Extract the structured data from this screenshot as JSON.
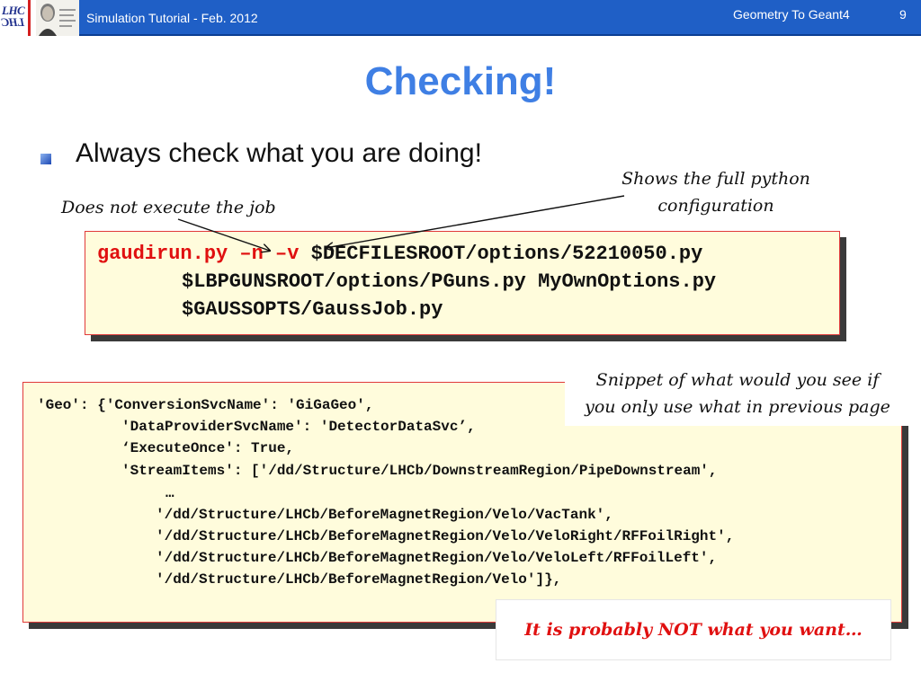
{
  "header": {
    "title": "Simulation Tutorial - Feb. 2012",
    "section": "Geometry To Geant4",
    "page_number": "9",
    "logo_text_top": "LHC",
    "logo_text_bottom": "LHC"
  },
  "slide": {
    "title": "Checking!",
    "bullet": "Always check what you are doing!"
  },
  "annotations": {
    "no_execute": "Does not execute the job",
    "python_config_line1": "Shows the full python",
    "python_config_line2": "configuration",
    "snippet_line1": "Snippet of what would you see if",
    "snippet_line2": "you only use what in previous page",
    "not_what_you_want": "It is probably NOT what you want…"
  },
  "command": {
    "prefix": "gaudirun.py –n –v ",
    "line1_rest": "$DECFILESROOT/options/52210050.py",
    "line2": "$LBPGUNSROOT/options/PGuns.py MyOwnOptions.py",
    "line3": "$GAUSSOPTS/GaussJob.py"
  },
  "config_snippet": {
    "lines": [
      "'Geo': {'ConversionSvcName': 'GiGaGeo',",
      "'DataProviderSvcName': 'DetectorDataSvc’,",
      "‘ExecuteOnce': True,",
      "'StreamItems': ['/dd/Structure/LHCb/DownstreamRegion/PipeDownstream',",
      "…",
      "'/dd/Structure/LHCb/BeforeMagnetRegion/Velo/VacTank',",
      "'/dd/Structure/LHCb/BeforeMagnetRegion/Velo/VeloRight/RFFoilRight',",
      "'/dd/Structure/LHCb/BeforeMagnetRegion/Velo/VeloLeft/RFFoilLeft',",
      "'/dd/Structure/LHCb/BeforeMagnetRegion/Velo']},"
    ]
  },
  "colors": {
    "header_bg": "#1f5fc6",
    "title": "#3f7fe4",
    "code_bg": "#fffcdc",
    "code_border": "#e03a3a",
    "highlight_red": "#e01010"
  },
  "icons": {
    "bullet": "blue-square-bullet-icon",
    "logo": "lhc-logo-icon",
    "portrait": "portrait-image"
  }
}
